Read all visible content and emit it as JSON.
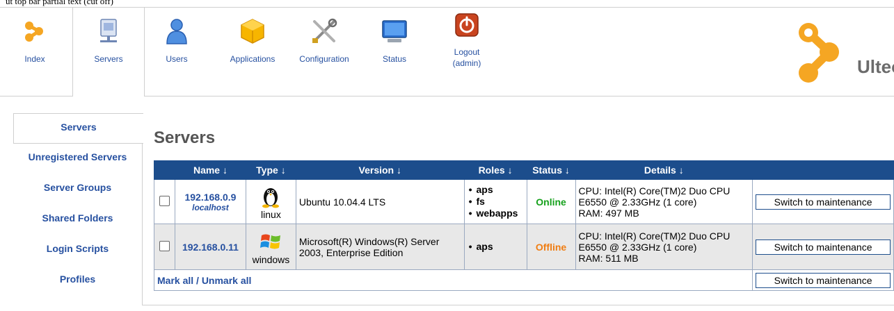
{
  "top_strip_text": "ut top bar partial text (cut off)",
  "nav": {
    "items": [
      {
        "label": "Index"
      },
      {
        "label": "Servers"
      },
      {
        "label": "Users"
      },
      {
        "label": "Applications"
      },
      {
        "label": "Configuration"
      },
      {
        "label": "Status"
      },
      {
        "label": "Logout",
        "sub": "(admin)"
      }
    ],
    "active": "Servers"
  },
  "brand": {
    "name": "Ulteo"
  },
  "sidebar": {
    "items": [
      {
        "label": "Servers"
      },
      {
        "label": "Unregistered Servers"
      },
      {
        "label": "Server Groups"
      },
      {
        "label": "Shared Folders"
      },
      {
        "label": "Login Scripts"
      },
      {
        "label": "Profiles"
      }
    ],
    "active": "Servers"
  },
  "page": {
    "title": "Servers"
  },
  "table": {
    "headers": [
      "Name ↓",
      "Type ↓",
      "Version ↓",
      "Roles ↓",
      "Status ↓",
      "Details ↓"
    ],
    "rows": [
      {
        "ip": "192.168.0.9",
        "host": "localhost",
        "type": "linux",
        "version": "Ubuntu 10.04.4 LTS",
        "roles": [
          "aps",
          "fs",
          "webapps"
        ],
        "status": "Online",
        "details": [
          "CPU: Intel(R) Core(TM)2 Duo CPU",
          "E6550 @ 2.33GHz (1 core)",
          "RAM: 497 MB"
        ],
        "action": "Switch to maintenance"
      },
      {
        "ip": "192.168.0.11",
        "host": "",
        "type": "windows",
        "version": "Microsoft(R) Windows(R) Server 2003, Enterprise Edition",
        "roles": [
          "aps"
        ],
        "status": "Offline",
        "details": [
          "CPU: Intel(R) Core(TM)2 Duo CPU",
          "E6550 @ 2.33GHz (1 core)",
          "RAM: 511 MB"
        ],
        "action": "Switch to maintenance"
      }
    ],
    "footer": {
      "mark_all": "Mark all",
      "separator": " / ",
      "unmark_all": "Unmark all",
      "action": "Switch to maintenance"
    }
  },
  "colors": {
    "accent": "#1c4d8c",
    "link": "#2650a0",
    "online": "#16a11c",
    "offline": "#f07d12"
  }
}
